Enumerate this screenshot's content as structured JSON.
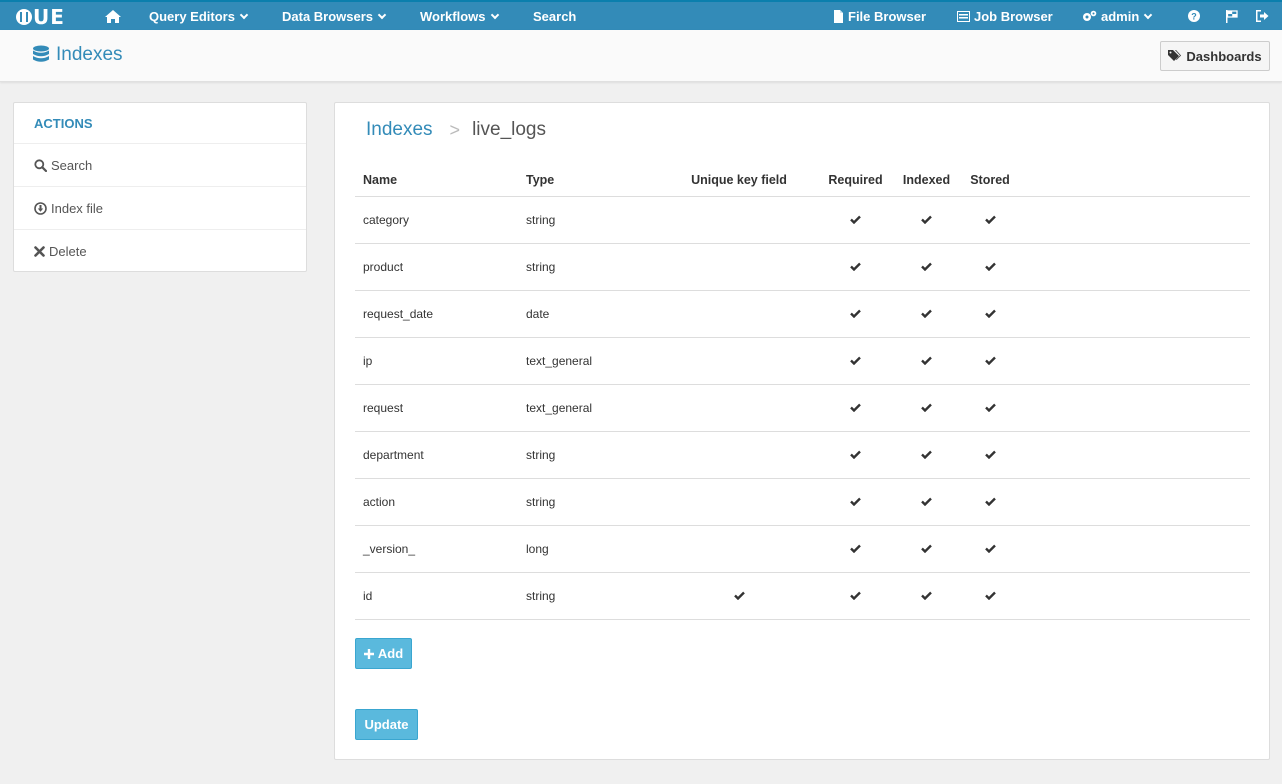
{
  "app": {
    "logo_text": "UE"
  },
  "topnav": {
    "query_editors": "Query Editors",
    "data_browsers": "Data Browsers",
    "workflows": "Workflows",
    "search": "Search",
    "file_browser": "File Browser",
    "job_browser": "Job Browser",
    "user": "admin"
  },
  "header": {
    "title": "Indexes",
    "dashboards_label": "Dashboards"
  },
  "sidebar": {
    "heading": "ACTIONS",
    "items": [
      {
        "label": "Search",
        "icon": "search-icon"
      },
      {
        "label": "Index file",
        "icon": "download-icon"
      },
      {
        "label": "Delete",
        "icon": "close-icon"
      }
    ]
  },
  "breadcrumb": {
    "root": "Indexes",
    "separator": ">",
    "current": "live_logs"
  },
  "table": {
    "columns": [
      "Name",
      "Type",
      "Unique key field",
      "Required",
      "Indexed",
      "Stored"
    ],
    "rows": [
      {
        "name": "category",
        "type": "string",
        "unique": false,
        "required": true,
        "indexed": true,
        "stored": true
      },
      {
        "name": "product",
        "type": "string",
        "unique": false,
        "required": true,
        "indexed": true,
        "stored": true
      },
      {
        "name": "request_date",
        "type": "date",
        "unique": false,
        "required": true,
        "indexed": true,
        "stored": true
      },
      {
        "name": "ip",
        "type": "text_general",
        "unique": false,
        "required": true,
        "indexed": true,
        "stored": true
      },
      {
        "name": "request",
        "type": "text_general",
        "unique": false,
        "required": true,
        "indexed": true,
        "stored": true
      },
      {
        "name": "department",
        "type": "string",
        "unique": false,
        "required": true,
        "indexed": true,
        "stored": true
      },
      {
        "name": "action",
        "type": "string",
        "unique": false,
        "required": true,
        "indexed": true,
        "stored": true
      },
      {
        "name": "_version_",
        "type": "long",
        "unique": false,
        "required": true,
        "indexed": true,
        "stored": true
      },
      {
        "name": "id",
        "type": "string",
        "unique": true,
        "required": true,
        "indexed": true,
        "stored": true
      }
    ]
  },
  "actions": {
    "add_label": "Add",
    "update_label": "Update"
  },
  "colors": {
    "nav": "#338bb8",
    "accent": "#338bb8",
    "button": "#5ab9dd"
  }
}
